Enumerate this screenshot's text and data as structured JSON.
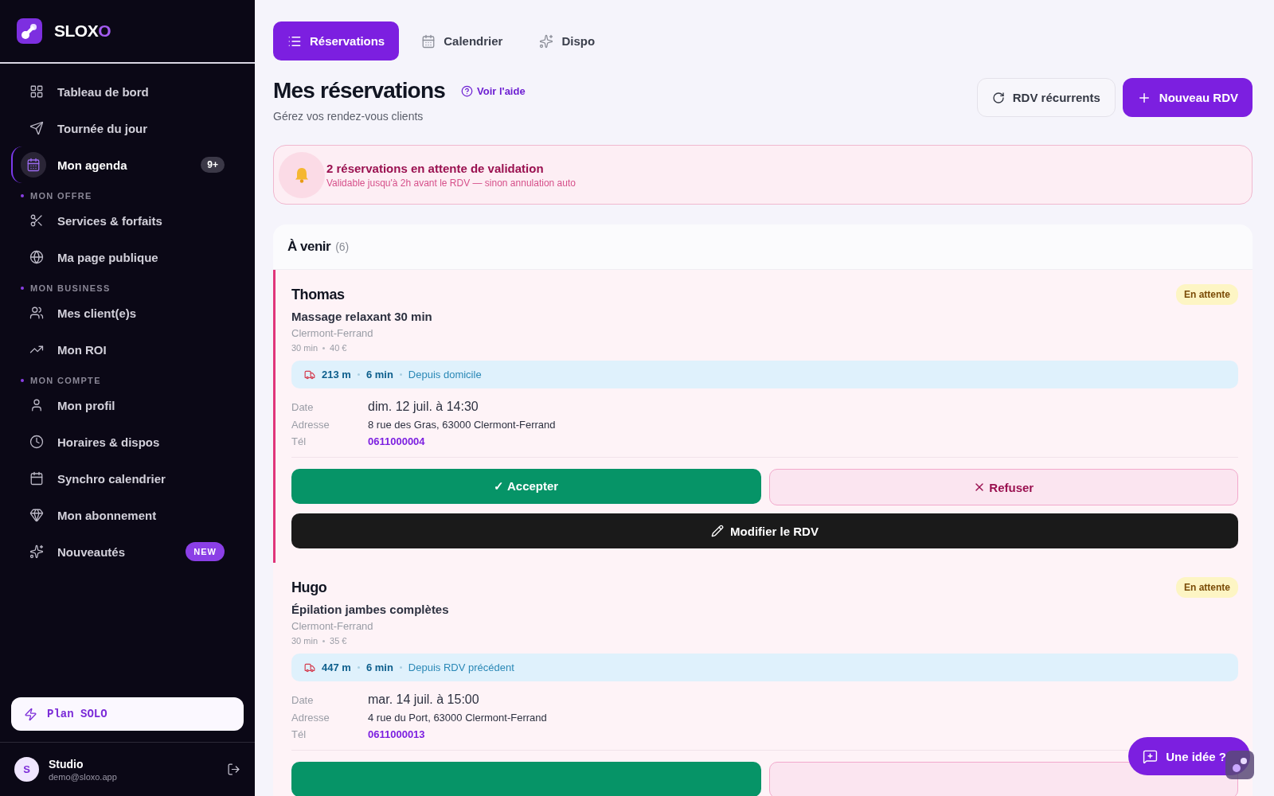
{
  "brand": {
    "name": "SLOX",
    "accent": "O"
  },
  "nav": [
    {
      "kind": "item",
      "label": "Tableau de bord",
      "selected": false
    },
    {
      "kind": "item",
      "label": "Tournée du jour",
      "selected": false
    },
    {
      "kind": "item",
      "label": "Mon agenda",
      "selected": true,
      "badge": "9+"
    },
    {
      "kind": "section",
      "label": "MON OFFRE"
    },
    {
      "kind": "item",
      "label": "Services & forfaits",
      "selected": false
    },
    {
      "kind": "item",
      "label": "Ma page publique",
      "selected": false
    },
    {
      "kind": "section",
      "label": "MON BUSINESS"
    },
    {
      "kind": "item",
      "label": "Mes client(e)s",
      "selected": false
    },
    {
      "kind": "item",
      "label": "Mon ROI",
      "selected": false
    },
    {
      "kind": "section",
      "label": "MON COMPTE"
    },
    {
      "kind": "item",
      "label": "Mon profil",
      "selected": false
    },
    {
      "kind": "item",
      "label": "Horaires & dispos",
      "selected": false
    },
    {
      "kind": "item",
      "label": "Synchro calendrier",
      "selected": false
    },
    {
      "kind": "item",
      "label": "Mon abonnement",
      "selected": false
    },
    {
      "kind": "item",
      "label": "Nouveautés",
      "selected": false,
      "pill": "NEW"
    }
  ],
  "plan": "Plan SOLO",
  "user": {
    "initial": "S",
    "name": "Studio",
    "email": "demo@sloxo.app"
  },
  "tabs": [
    {
      "label": "Réservations",
      "selected": true
    },
    {
      "label": "Calendrier",
      "selected": false
    },
    {
      "label": "Dispo",
      "selected": false
    }
  ],
  "header": {
    "title": "Mes réservations",
    "help": "Voir l'aide",
    "subtitle": "Gérez vos rendez-vous clients",
    "buttons": [
      {
        "kind": "secondary",
        "label": "RDV récurrents"
      },
      {
        "kind": "primary",
        "label": "Nouveau RDV"
      }
    ]
  },
  "alert": {
    "title": "2 réservations en attente de validation",
    "text": "Validable jusqu'à 2h avant le RDV — sinon annulation auto"
  },
  "list": {
    "title": "À venir",
    "count": "(6)"
  },
  "bookings": [
    {
      "name": "Thomas",
      "status": "En attente",
      "service": "Massage relaxant 30 min",
      "city": "Clermont-Ferrand",
      "duration": "30 min",
      "price": "40 €",
      "distance": "213 m",
      "travel_time": "6 min",
      "origin": "Depuis domicile",
      "highlighted": true,
      "details": [
        {
          "label": "Date",
          "value": "dim. 12 juil. à 14:30",
          "kind": "date"
        },
        {
          "label": "Adresse",
          "value": "8 rue des Gras, 63000 Clermont-Ferrand",
          "kind": "text"
        },
        {
          "label": "Tél",
          "value": "0611000004",
          "kind": "phone"
        }
      ],
      "actions": {
        "accept": "✓ Accepter",
        "refuse": "Refuser",
        "edit": "Modifier le RDV"
      }
    },
    {
      "name": "Hugo",
      "status": "En attente",
      "service": "Épilation jambes complètes",
      "city": "Clermont-Ferrand",
      "duration": "30 min",
      "price": "35 €",
      "distance": "447 m",
      "travel_time": "6 min",
      "origin": "Depuis RDV précédent",
      "highlighted": false,
      "details": [
        {
          "label": "Date",
          "value": "mar. 14 juil. à 15:00",
          "kind": "date"
        },
        {
          "label": "Adresse",
          "value": "4 rue du Port, 63000 Clermont-Ferrand",
          "kind": "text"
        },
        {
          "label": "Tél",
          "value": "0611000013",
          "kind": "phone"
        }
      ],
      "partial_actions": true
    }
  ],
  "feedback": "Une idée ?"
}
